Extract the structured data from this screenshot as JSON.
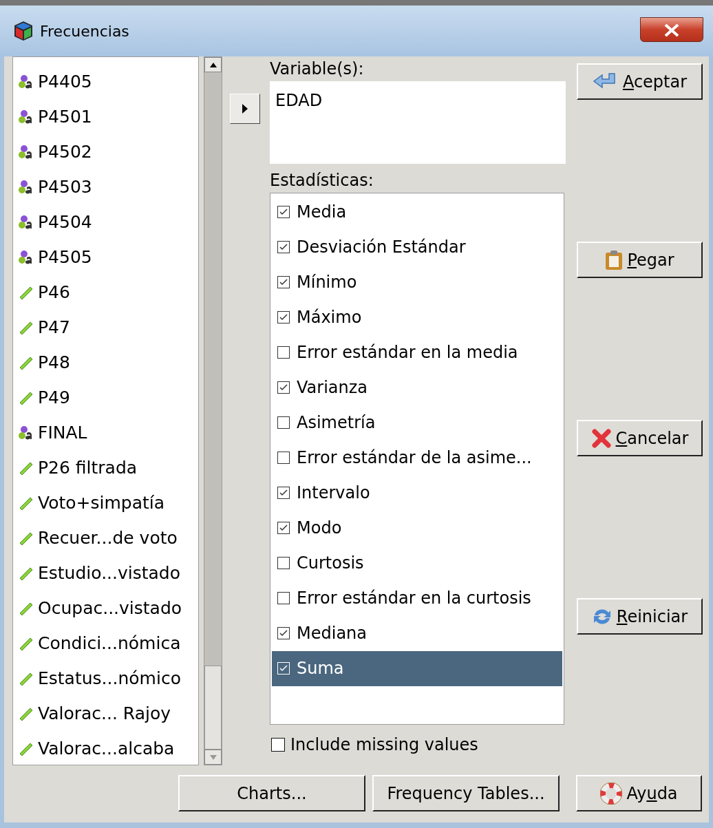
{
  "window": {
    "title": "Frecuencias"
  },
  "variables": [
    {
      "name": "P4405",
      "kind": "nominal"
    },
    {
      "name": "P4501",
      "kind": "nominal"
    },
    {
      "name": "P4502",
      "kind": "nominal"
    },
    {
      "name": "P4503",
      "kind": "nominal"
    },
    {
      "name": "P4504",
      "kind": "nominal"
    },
    {
      "name": "P4505",
      "kind": "nominal"
    },
    {
      "name": "P46",
      "kind": "scale"
    },
    {
      "name": "P47",
      "kind": "scale"
    },
    {
      "name": "P48",
      "kind": "scale"
    },
    {
      "name": "P49",
      "kind": "scale"
    },
    {
      "name": "FINAL",
      "kind": "nominal"
    },
    {
      "name": "P26 filtrada",
      "kind": "scale"
    },
    {
      "name": "Voto+simpatía",
      "kind": "scale"
    },
    {
      "name": "Recuer...de voto",
      "kind": "scale"
    },
    {
      "name": "Estudio...vistado",
      "kind": "scale"
    },
    {
      "name": "Ocupac...vistado",
      "kind": "scale"
    },
    {
      "name": "Condici...nómica",
      "kind": "scale"
    },
    {
      "name": "Estatus...nómico",
      "kind": "scale"
    },
    {
      "name": "Valorac... Rajoy",
      "kind": "scale"
    },
    {
      "name": "Valorac...alcaba",
      "kind": "scale"
    }
  ],
  "variables_label": "Variable(s):",
  "selected_variables": [
    "EDAD"
  ],
  "statistics_label": "Estadísticas:",
  "statistics": [
    {
      "label": "Media",
      "checked": true,
      "selected": false
    },
    {
      "label": "Desviación Estándar",
      "checked": true,
      "selected": false
    },
    {
      "label": "Mínimo",
      "checked": true,
      "selected": false
    },
    {
      "label": "Máximo",
      "checked": true,
      "selected": false
    },
    {
      "label": "Error estándar en la media",
      "checked": false,
      "selected": false
    },
    {
      "label": "Varianza",
      "checked": true,
      "selected": false
    },
    {
      "label": "Asimetría",
      "checked": false,
      "selected": false
    },
    {
      "label": "Error estándar de la asime...",
      "checked": false,
      "selected": false
    },
    {
      "label": "Intervalo",
      "checked": true,
      "selected": false
    },
    {
      "label": "Modo",
      "checked": true,
      "selected": false
    },
    {
      "label": "Curtosis",
      "checked": false,
      "selected": false
    },
    {
      "label": "Error estándar en la curtosis",
      "checked": false,
      "selected": false
    },
    {
      "label": "Mediana",
      "checked": true,
      "selected": false
    },
    {
      "label": "Suma",
      "checked": true,
      "selected": true
    }
  ],
  "include_missing": {
    "label": "Include missing values",
    "checked": false
  },
  "side_buttons": [
    {
      "kind": "ok",
      "label": {
        "key": "A",
        "after": "ceptar"
      }
    },
    {
      "kind": "paste",
      "label": {
        "key": "P",
        "after": "egar"
      }
    },
    {
      "kind": "cancel",
      "label": {
        "key": "C",
        "after": "ancelar"
      }
    },
    {
      "kind": "reset",
      "label": {
        "key": "R",
        "after": "einiciar"
      }
    }
  ],
  "bottom_buttons": [
    {
      "kind": "plain",
      "label": {
        "before": "Charts..."
      }
    },
    {
      "kind": "plain",
      "label": {
        "before": "Frequency Tables..."
      }
    },
    {
      "kind": "help",
      "label": {
        "before": "Ay",
        "key": "u",
        "after": "da"
      }
    }
  ]
}
